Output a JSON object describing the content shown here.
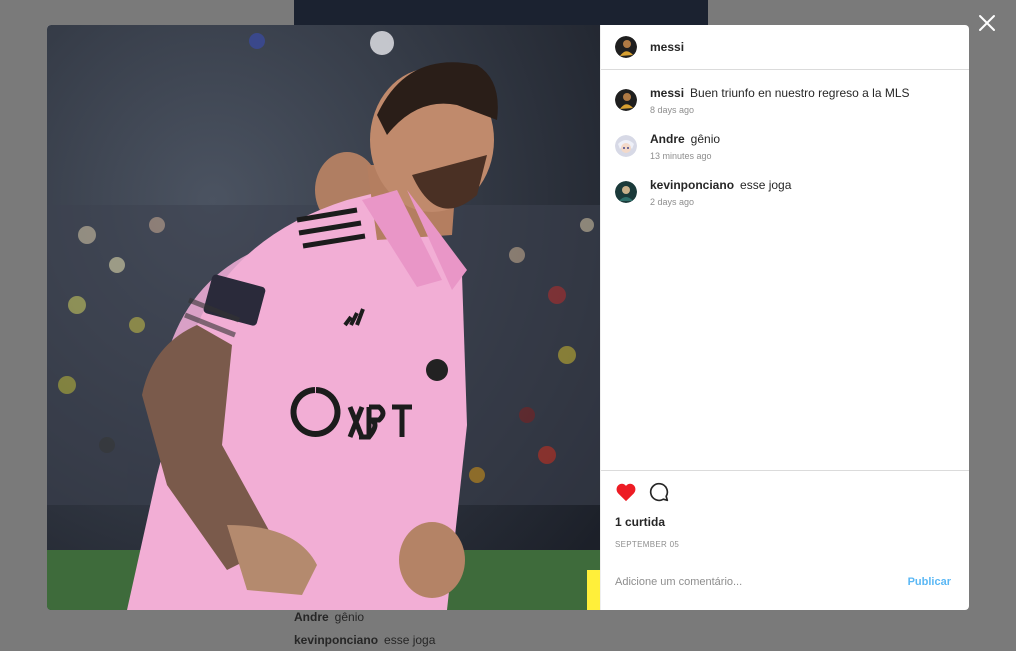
{
  "post": {
    "author": "messi",
    "likes_label": "1 curtida",
    "date": "SEPTEMBER 05",
    "liked": true,
    "accent_like_color": "#ed4956",
    "accent_link_color": "#5bb8f5"
  },
  "comments": [
    {
      "user": "messi",
      "text": "Buen triunfo en nuestro regreso a la MLS",
      "time": "8 days ago"
    },
    {
      "user": "Andre",
      "text": "gênio",
      "time": "13 minutes ago"
    },
    {
      "user": "kevinponciano",
      "text": "esse joga",
      "time": "2 days ago"
    }
  ],
  "add_comment": {
    "placeholder": "Adicione um comentário...",
    "publish_label": "Publicar"
  },
  "background_feed": [
    {
      "user": "Andre",
      "text": "gênio"
    },
    {
      "user": "kevinponciano",
      "text": "esse joga"
    }
  ],
  "icons": {
    "close": "close-icon",
    "like": "heart-icon",
    "comment": "comment-bubble-icon"
  }
}
